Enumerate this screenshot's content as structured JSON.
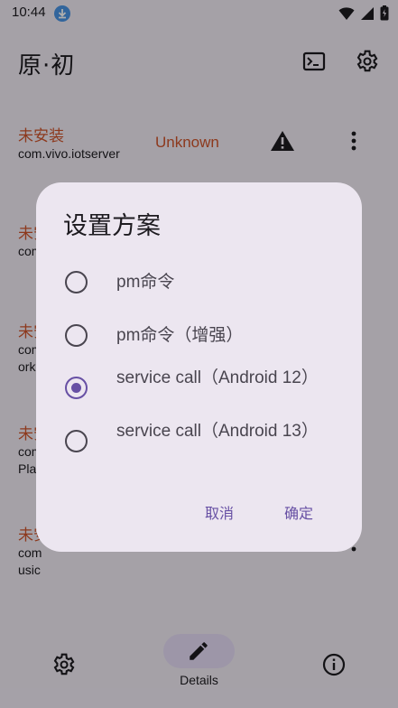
{
  "status_bar": {
    "time": "10:44"
  },
  "app_bar": {
    "title": "原·初"
  },
  "list": {
    "items": [
      {
        "status": "未安装",
        "package": "com.vivo.iotserver",
        "state": "Unknown"
      },
      {
        "status": "未安装",
        "package": "com"
      },
      {
        "status": "未安装",
        "package": "com\norkd"
      },
      {
        "status": "未安装",
        "package": "com\nPla"
      },
      {
        "status": "未安装",
        "package": "com\nusic"
      }
    ]
  },
  "dialog": {
    "title": "设置方案",
    "options": [
      {
        "label": "pm命令",
        "checked": false
      },
      {
        "label": "pm命令（增强）",
        "checked": false
      },
      {
        "label": "service call（Android 12）",
        "checked": true
      },
      {
        "label": "service call（Android 13）",
        "checked": false
      }
    ],
    "cancel_label": "取消",
    "ok_label": "确定"
  },
  "bottom_nav": {
    "details_label": "Details"
  },
  "colors": {
    "accent": "#6750a4",
    "warning_text": "#d0552c",
    "surface": "#f3eef7",
    "dialog": "#ece6f0"
  }
}
